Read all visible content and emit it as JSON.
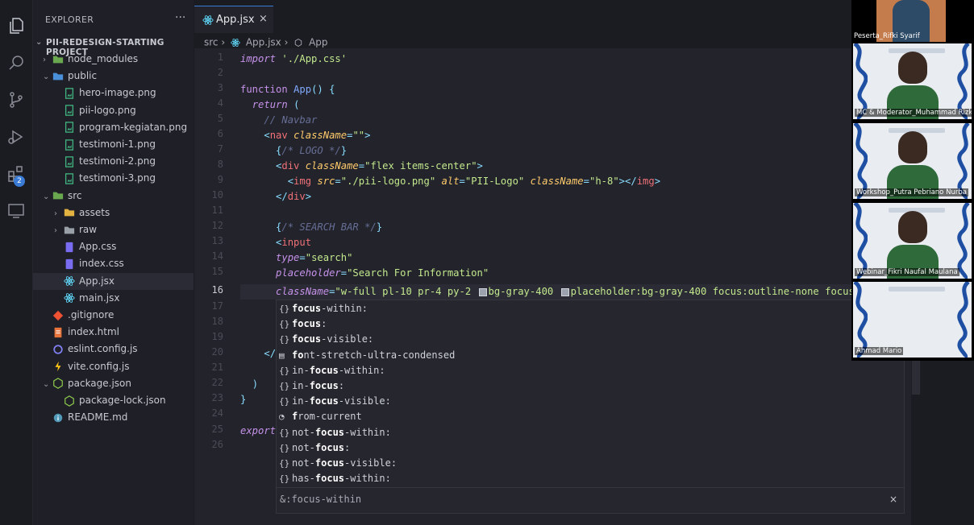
{
  "explorer": {
    "title": "EXPLORER",
    "more": "···",
    "project": "PII-REDESIGN-STARTING PROJECT",
    "items": [
      {
        "label": "node_modules",
        "depth": 1,
        "kind": "folder-green",
        "chevron": "›"
      },
      {
        "label": "public",
        "depth": 1,
        "kind": "folder-blue",
        "chevron": "⌄"
      },
      {
        "label": "hero-image.png",
        "depth": 2,
        "kind": "img"
      },
      {
        "label": "pii-logo.png",
        "depth": 2,
        "kind": "img"
      },
      {
        "label": "program-kegiatan.png",
        "depth": 2,
        "kind": "img"
      },
      {
        "label": "testimoni-1.png",
        "depth": 2,
        "kind": "img"
      },
      {
        "label": "testimoni-2.png",
        "depth": 2,
        "kind": "img"
      },
      {
        "label": "testimoni-3.png",
        "depth": 2,
        "kind": "img"
      },
      {
        "label": "src",
        "depth": 1,
        "kind": "folder-green",
        "chevron": "⌄"
      },
      {
        "label": "assets",
        "depth": 2,
        "kind": "folder-yellow",
        "chevron": "›"
      },
      {
        "label": "raw",
        "depth": 2,
        "kind": "folder-gray",
        "chevron": "›"
      },
      {
        "label": "App.css",
        "depth": 2,
        "kind": "css"
      },
      {
        "label": "index.css",
        "depth": 2,
        "kind": "css"
      },
      {
        "label": "App.jsx",
        "depth": 2,
        "kind": "react",
        "active": true
      },
      {
        "label": "main.jsx",
        "depth": 2,
        "kind": "react"
      },
      {
        "label": ".gitignore",
        "depth": 1,
        "kind": "git"
      },
      {
        "label": "index.html",
        "depth": 1,
        "kind": "html"
      },
      {
        "label": "eslint.config.js",
        "depth": 1,
        "kind": "eslint"
      },
      {
        "label": "vite.config.js",
        "depth": 1,
        "kind": "vite"
      },
      {
        "label": "package.json",
        "depth": 1,
        "kind": "node",
        "chevron": "⌄"
      },
      {
        "label": "package-lock.json",
        "depth": 2,
        "kind": "node"
      },
      {
        "label": "README.md",
        "depth": 1,
        "kind": "info"
      }
    ]
  },
  "activity": {
    "badge": "2"
  },
  "tab": {
    "label": "App.jsx",
    "close": "×"
  },
  "breadcrumb": {
    "part1": "src",
    "sep": "›",
    "part2": "App.jsx",
    "part3": "App"
  },
  "editor": {
    "line_numbers": [
      "1",
      "2",
      "3",
      "4",
      "5",
      "6",
      "7",
      "8",
      "9",
      "10",
      "11",
      "12",
      "13",
      "14",
      "15",
      "16",
      "17",
      "18",
      "19",
      "20",
      "21",
      "22",
      "23",
      "24",
      "25",
      "26"
    ],
    "current_line": "16"
  },
  "suggestions": {
    "items": [
      {
        "icon": "{}",
        "pre": "",
        "hl": "focus",
        "post": "-within:"
      },
      {
        "icon": "{}",
        "pre": "",
        "hl": "focus",
        "post": ":"
      },
      {
        "icon": "{}",
        "pre": "",
        "hl": "focus",
        "post": "-visible:"
      },
      {
        "icon": "▤",
        "pre": "",
        "hl": "fo",
        "post": "nt-stretch-ultra-condensed"
      },
      {
        "icon": "{}",
        "pre": "in-",
        "hl": "focus",
        "post": "-within:"
      },
      {
        "icon": "{}",
        "pre": "in-",
        "hl": "focus",
        "post": ":"
      },
      {
        "icon": "{}",
        "pre": "in-",
        "hl": "focus",
        "post": "-visible:"
      },
      {
        "icon": "◔",
        "pre": "",
        "hl": "f",
        "post": "rom-current"
      },
      {
        "icon": "{}",
        "pre": "not-",
        "hl": "focus",
        "post": "-within:"
      },
      {
        "icon": "{}",
        "pre": "not-",
        "hl": "focus",
        "post": ":"
      },
      {
        "icon": "{}",
        "pre": "not-",
        "hl": "focus",
        "post": "-visible:"
      },
      {
        "icon": "{}",
        "pre": "has-",
        "hl": "focus",
        "post": "-within:"
      }
    ],
    "detail": "&:focus-within",
    "close": "×"
  },
  "participants": [
    {
      "name": "Peserta_Rifki Syarif"
    },
    {
      "name": "MC & Moderator_Muhammad Rizky"
    },
    {
      "name": "Workshop_Putra Pebriano Nurba"
    },
    {
      "name": "Webinar_Fikri Naufal Maulana"
    },
    {
      "name": "Ahmad Mario"
    }
  ]
}
